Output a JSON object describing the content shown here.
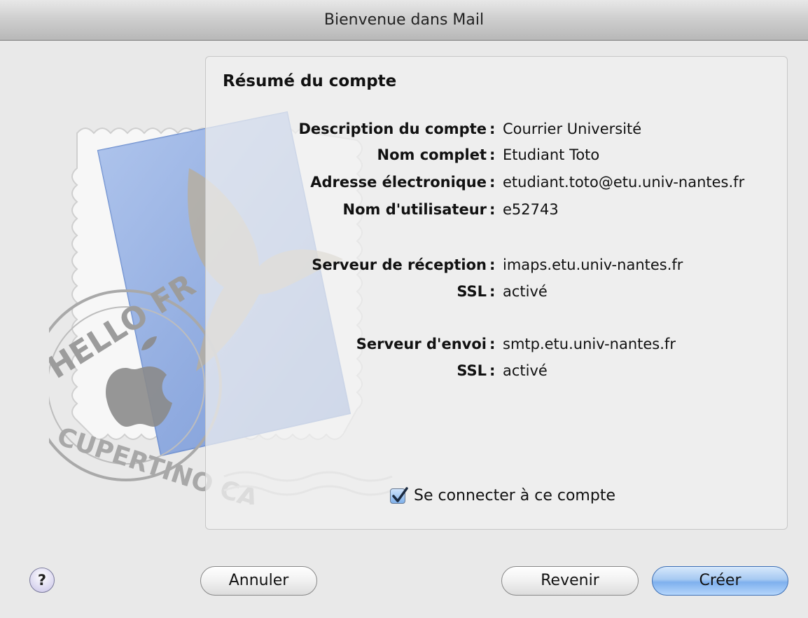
{
  "window": {
    "title": "Bienvenue dans Mail"
  },
  "summary": {
    "heading": "Résumé du compte",
    "rows": [
      {
        "label": "Description du compte",
        "value": "Courrier Université"
      },
      {
        "label": "Nom complet",
        "value": "Etudiant Toto"
      },
      {
        "label": "Adresse électronique",
        "value": "etudiant.toto@etu.univ-nantes.fr"
      },
      {
        "label": "Nom d'utilisateur",
        "value": "e52743"
      },
      {
        "label": "Serveur de réception",
        "value": "imaps.etu.univ-nantes.fr"
      },
      {
        "label": "SSL",
        "value": "activé"
      },
      {
        "label": "Serveur d'envoi",
        "value": "smtp.etu.univ-nantes.fr"
      },
      {
        "label": "SSL",
        "value": "activé"
      }
    ],
    "colon": ":"
  },
  "connect": {
    "label": "Se connecter à ce compte",
    "checked": true
  },
  "buttons": {
    "help": "?",
    "cancel": "Annuler",
    "back": "Revenir",
    "create": "Créer"
  },
  "stamp": {
    "top_text": "HELLO FR",
    "bottom_text": "CUPERTINO CA"
  },
  "icons": {
    "help": "question-mark-icon",
    "checkbox": "checkmark-icon",
    "stamp": "mail-stamp-icon"
  },
  "colors": {
    "primary_button": "#7fb0ee",
    "checkbox": "#7fb0ea",
    "stamp_letter": "#8aa8e0"
  }
}
